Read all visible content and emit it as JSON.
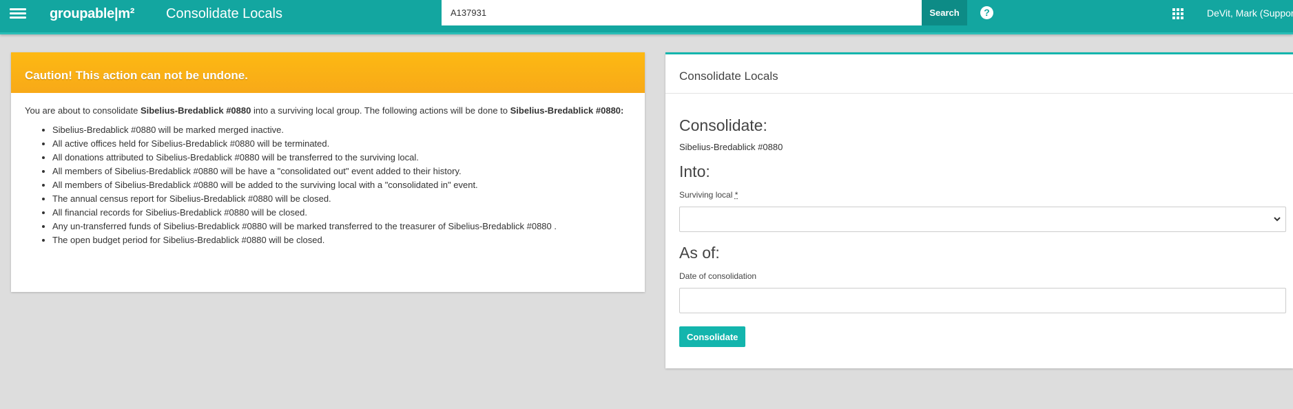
{
  "header": {
    "brand": "groupable|m²",
    "page_title": "Consolidate Locals",
    "search_value": "A137931",
    "search_label": "Search",
    "help_glyph": "?",
    "user_name": "DeVit, Mark (Suppor",
    "icons": [
      "hamburger-menu-icon",
      "help-icon",
      "apps-grid-icon"
    ]
  },
  "caution": {
    "title": "Caution! This action can not be undone.",
    "intro_pre": "You are about to consolidate ",
    "intro_local": "Sibelius-Bredablick #0880",
    "intro_mid": " into a surviving local group. The following actions will be done to ",
    "intro_local2": "Sibelius-Bredablick #0880:",
    "actions": [
      "Sibelius-Bredablick #0880 will be marked merged inactive.",
      "All active offices held for Sibelius-Bredablick #0880 will be terminated.",
      "All donations attributed to Sibelius-Bredablick #0880 will be transferred to the surviving local.",
      "All members of Sibelius-Bredablick #0880 will be have a \"consolidated out\" event added to their history.",
      "All members of Sibelius-Bredablick #0880 will be added to the surviving local with a \"consolidated in\" event.",
      "The annual census report for Sibelius-Bredablick #0880 will be closed.",
      "All financial records for Sibelius-Bredablick #0880 will be closed.",
      "Any un-transferred funds of Sibelius-Bredablick #0880 will be marked transferred to the treasurer of Sibelius-Bredablick #0880 .",
      "The open budget period for Sibelius-Bredablick #0880 will be closed."
    ]
  },
  "form": {
    "card_title": "Consolidate Locals",
    "consolidate_heading": "Consolidate:",
    "local_name": "Sibelius-Bredablick #0880",
    "into_heading": "Into:",
    "surviving_label": "Surviving local",
    "required_mark": "*",
    "surviving_value": "",
    "asof_heading": "As of:",
    "date_label": "Date of consolidation",
    "date_value": "",
    "submit_label": "Consolidate"
  },
  "colors": {
    "header_bg": "#13a6a0",
    "accent": "#13b5ad",
    "caution": "#fdb913",
    "search_button": "#0d8b86"
  }
}
